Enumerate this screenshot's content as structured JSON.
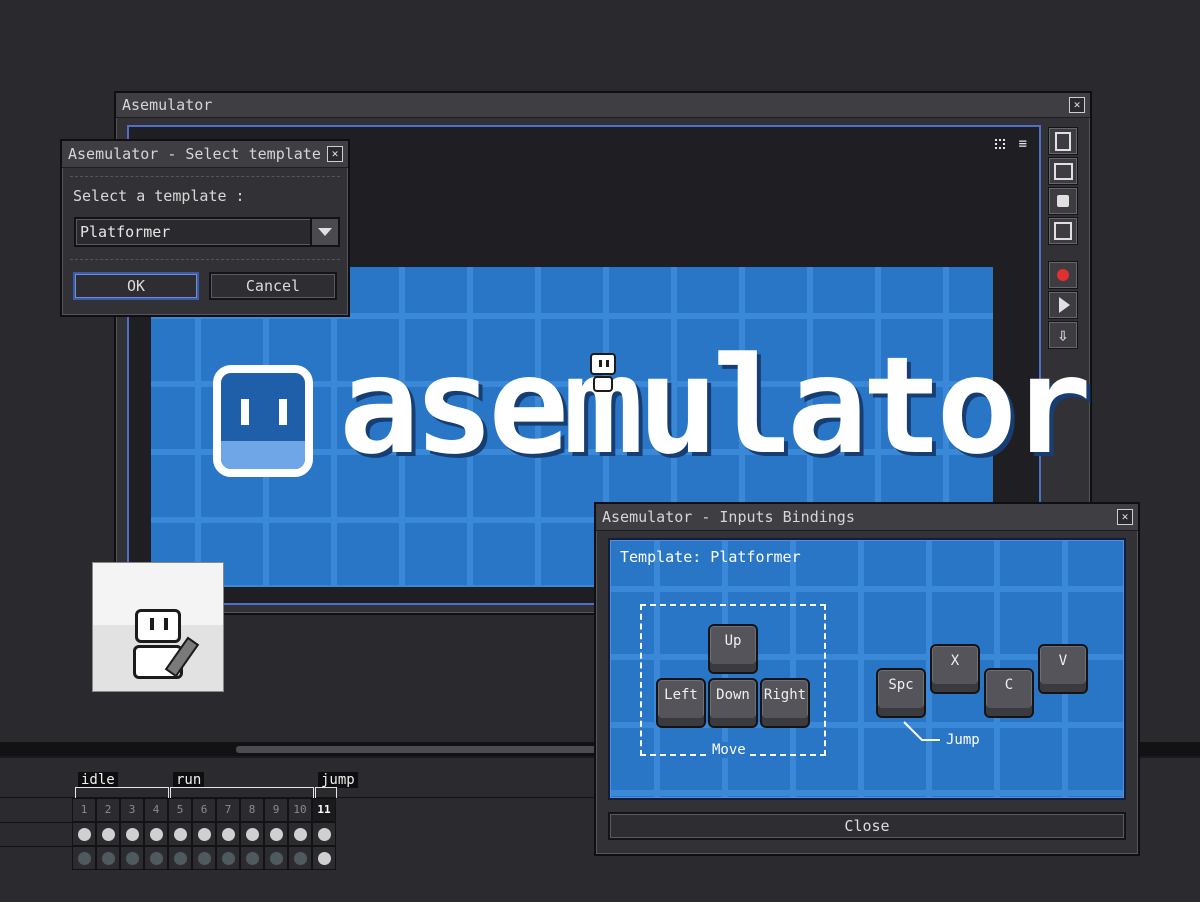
{
  "main_window": {
    "title": "Asemulator"
  },
  "logo_text": "asemulator",
  "template_dialog": {
    "title": "Asemulator - Select template",
    "prompt": "Select a template :",
    "selected": "Platformer",
    "ok": "OK",
    "cancel": "Cancel"
  },
  "bindings_dialog": {
    "title": "Asemulator - Inputs Bindings",
    "template_label": "Template: Platformer",
    "keys": {
      "up": "Up",
      "left": "Left",
      "down": "Down",
      "right": "Right",
      "spc": "Spc",
      "x": "X",
      "c": "C",
      "v": "V"
    },
    "move_label": "Move",
    "jump_label": "Jump",
    "close": "Close"
  },
  "timeline": {
    "tags": {
      "idle": "idle",
      "run": "run",
      "jump": "jump"
    },
    "frames": [
      "1",
      "2",
      "3",
      "4",
      "5",
      "6",
      "7",
      "8",
      "9",
      "10",
      "11"
    ]
  },
  "colors": {
    "accent_blue": "#2a76c6",
    "record_red": "#e03030"
  }
}
